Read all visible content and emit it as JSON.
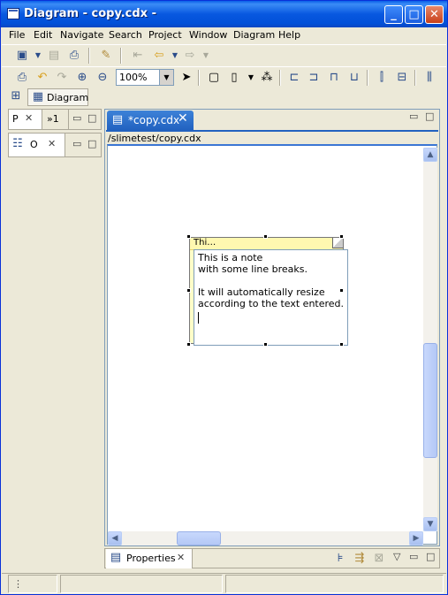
{
  "window": {
    "title": "Diagram - copy.cdx -",
    "controls": {
      "minimize": "_",
      "maximize": "□",
      "close": "✕"
    }
  },
  "menubar": [
    "File",
    "Edit",
    "Navigate",
    "Search",
    "Project",
    "Window",
    "Diagram",
    "Help"
  ],
  "toolbar": {
    "zoom_value": "100%"
  },
  "perspective": {
    "label": "Diagram"
  },
  "left_views": {
    "top_tabs": [
      "P",
      "»1"
    ],
    "outline_tab": "O"
  },
  "editor": {
    "tab_label": "*copy.cdx",
    "path": "/slimetest/copy.cdx",
    "note": {
      "header_text": "Thi…",
      "lines": [
        "This is a note",
        "with some line breaks.",
        "",
        "It will automatically resize",
        "according to the text entered."
      ]
    }
  },
  "properties": {
    "tab_label": "Properties"
  },
  "icons": {
    "accent": "#2262c0",
    "title_gradient": "#0858e0"
  }
}
